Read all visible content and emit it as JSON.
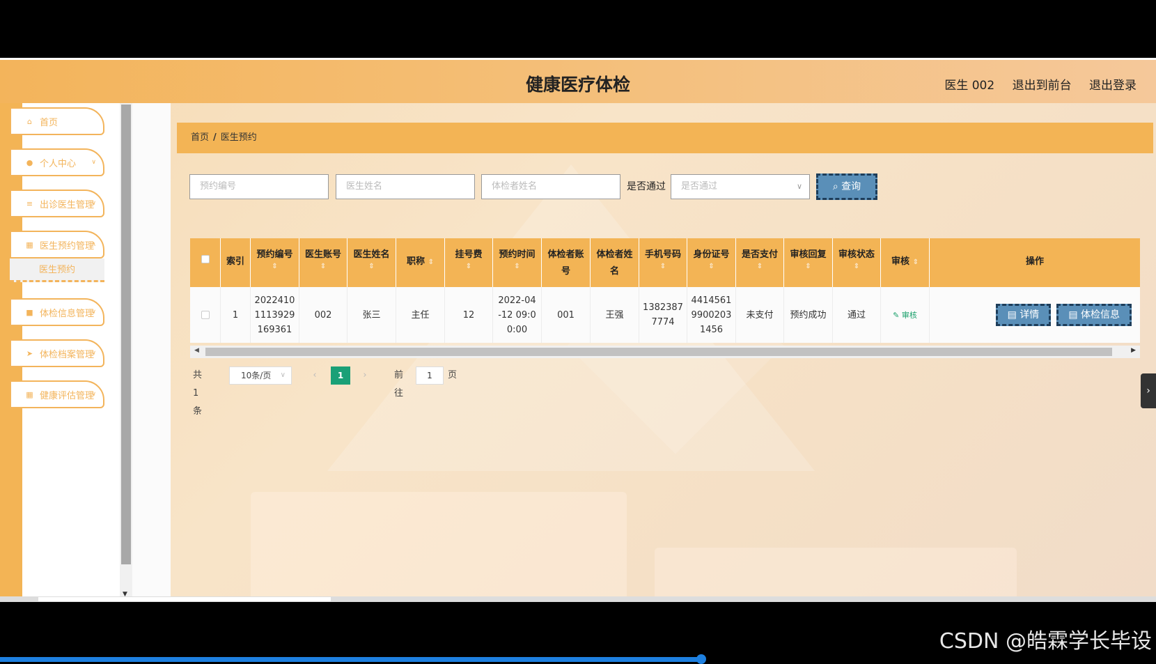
{
  "header": {
    "title": "健康医疗体检",
    "user": "医生 002",
    "back_to_front": "退出到前台",
    "logout": "退出登录"
  },
  "sidebar": {
    "items": [
      {
        "label": "首页",
        "icon": "home-icon"
      },
      {
        "label": "个人中心",
        "icon": "user-icon"
      },
      {
        "label": "出诊医生管理",
        "icon": "list-icon"
      },
      {
        "label": "医生预约管理",
        "icon": "grid-icon"
      },
      {
        "label": "体检信息管理",
        "icon": "clipboard-icon"
      },
      {
        "label": "体检档案管理",
        "icon": "send-icon"
      },
      {
        "label": "健康评估管理",
        "icon": "grid-icon"
      }
    ],
    "sub_item": "医生预约"
  },
  "breadcrumb": {
    "home": "首页",
    "sep": "/",
    "current": "医生预约"
  },
  "filters": {
    "booking_no_placeholder": "预约编号",
    "doctor_name_placeholder": "医生姓名",
    "patient_name_placeholder": "体检者姓名",
    "approved_label": "是否通过",
    "approved_placeholder": "是否通过",
    "query_button": "查询"
  },
  "table": {
    "headers": [
      "索引",
      "预约编号",
      "医生账号",
      "医生姓名",
      "职称",
      "挂号费",
      "预约时间",
      "体检者账号",
      "体检者姓名",
      "手机号码",
      "身份证号",
      "是否支付",
      "审核回复",
      "审核状态",
      "审核",
      "操作"
    ],
    "rows": [
      {
        "index": "1",
        "booking_no": "2022410 1113929 169361",
        "doctor_account": "002",
        "doctor_name": "张三",
        "title": "主任",
        "fee": "12",
        "time": "2022-04 -12 09:0 0:00",
        "patient_account": "001",
        "patient_name": "王强",
        "phone": "1382387 7774",
        "id_no": "4414561 9900203 1456",
        "paid": "未支付",
        "reply": "预约成功",
        "status": "通过",
        "audit": "审核",
        "detail_btn": "详情",
        "exam_btn": "体检信息"
      }
    ]
  },
  "pager": {
    "total": "共 1 条",
    "page_size": "10条/页",
    "current_page": "1",
    "goto_label": "前往",
    "goto_value": "1",
    "page_suffix": "页"
  },
  "watermark": "CSDN @皓霖学长毕设",
  "colors": {
    "accent": "#f3b455",
    "button": "#5a8fb8",
    "pager_active": "#1aa077"
  }
}
